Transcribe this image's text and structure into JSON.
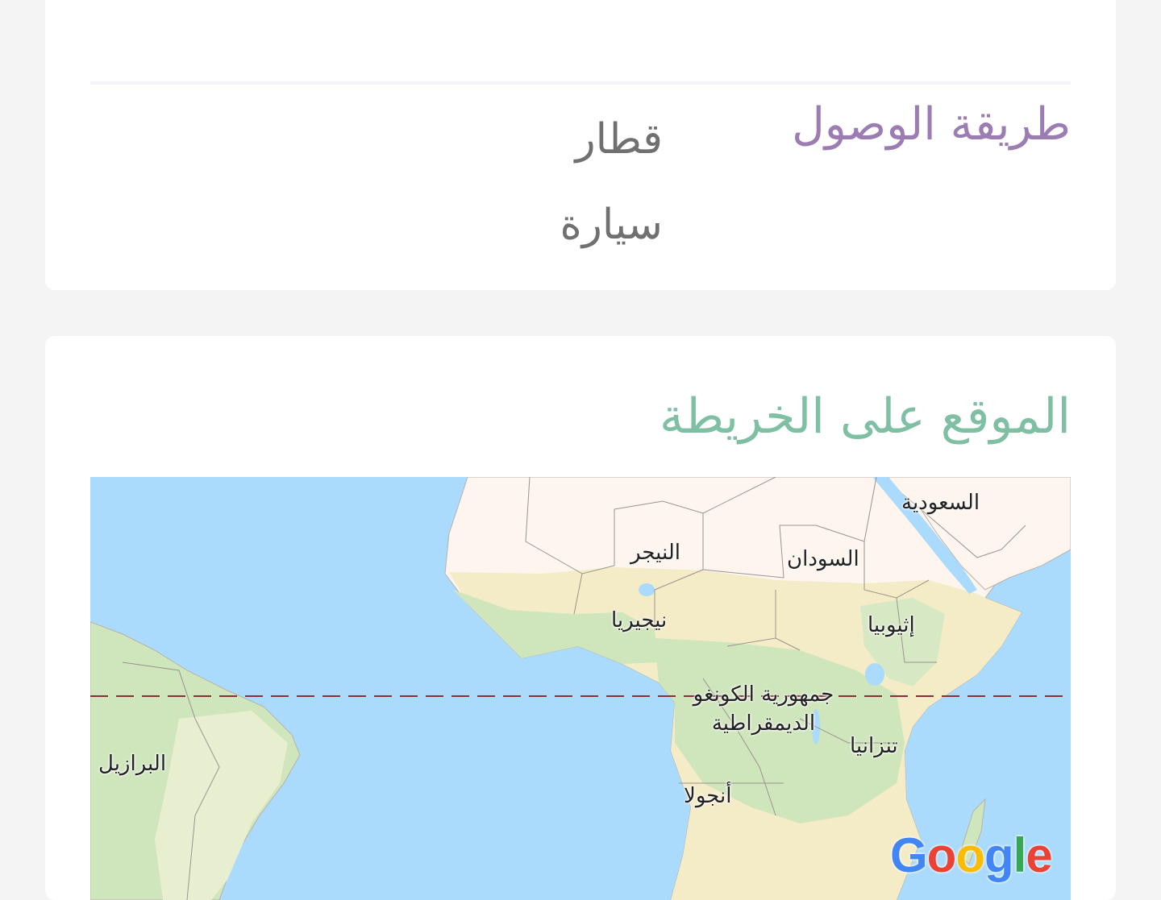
{
  "access": {
    "label": "طريقة الوصول",
    "options": [
      "قطار",
      "سيارة"
    ]
  },
  "map_section": {
    "title": "الموقع على الخريطة",
    "labels": {
      "saudi": "السعودية",
      "niger": "النيجر",
      "sudan": "السودان",
      "nigeria": "نيجيريا",
      "ethiopia": "إثيوبيا",
      "drc_line1": "جمهورية الكونغو",
      "drc_line2": "الديمقراطية",
      "tanzania": "تنزانيا",
      "brazil": "البرازيل",
      "angola": "أنجولا"
    },
    "logo": "Google"
  },
  "colors": {
    "access_label": "#9b7db3",
    "map_title": "#7fbfa4",
    "water": "#aadafc",
    "desert": "#fdf5ee",
    "savanna": "#f4ecc7",
    "forest": "#cfe5bc",
    "equator": "#8b2d3b"
  }
}
